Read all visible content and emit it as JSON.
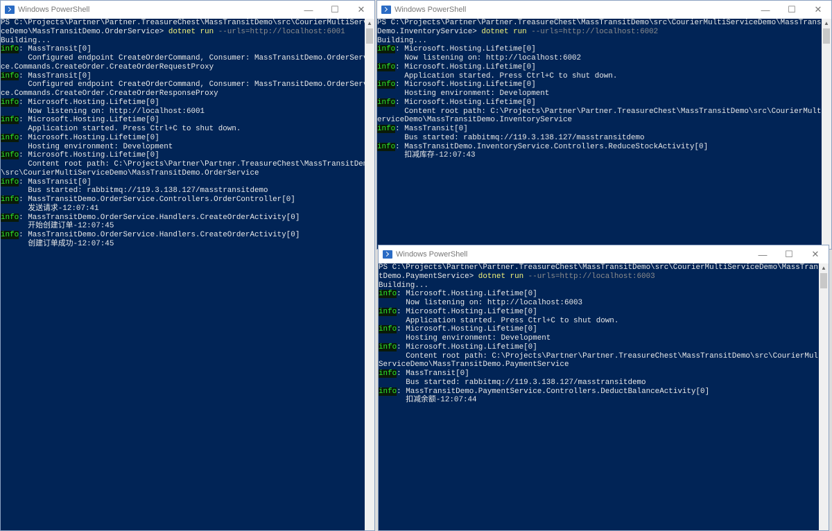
{
  "windows": [
    {
      "title": "Windows PowerShell",
      "controls": {
        "minimize": "—",
        "maximize": "☐",
        "close": "✕"
      },
      "lines": [
        {
          "text": "PS C:\\Projects\\Partner\\Partner.TreasureChest\\MassTransitDemo\\src\\CourierMultiServi"
        },
        {
          "text": "ceDemo\\MassTransitDemo.OrderService> ",
          "cmd": "dotnet run",
          "args": " --urls=http://localhost:6001"
        },
        {
          "text": "Building..."
        },
        {
          "info": "info",
          "text": ": MassTransit[0]"
        },
        {
          "text": "      Configured endpoint CreateOrderCommand, Consumer: MassTransitDemo.OrderServi"
        },
        {
          "text": "ce.Commands.CreateOrder.CreateOrderRequestProxy"
        },
        {
          "info": "info",
          "text": ": MassTransit[0]"
        },
        {
          "text": "      Configured endpoint CreateOrderCommand, Consumer: MassTransitDemo.OrderServi"
        },
        {
          "text": "ce.Commands.CreateOrder.CreateOrderResponseProxy"
        },
        {
          "info": "info",
          "text": ": Microsoft.Hosting.Lifetime[0]"
        },
        {
          "text": "      Now listening on: http://localhost:6001"
        },
        {
          "info": "info",
          "text": ": Microsoft.Hosting.Lifetime[0]"
        },
        {
          "text": "      Application started. Press Ctrl+C to shut down."
        },
        {
          "info": "info",
          "text": ": Microsoft.Hosting.Lifetime[0]"
        },
        {
          "text": "      Hosting environment: Development"
        },
        {
          "info": "info",
          "text": ": Microsoft.Hosting.Lifetime[0]"
        },
        {
          "text": "      Content root path: C:\\Projects\\Partner\\Partner.TreasureChest\\MassTransitDemo"
        },
        {
          "text": "\\src\\CourierMultiServiceDemo\\MassTransitDemo.OrderService"
        },
        {
          "info": "info",
          "text": ": MassTransit[0]"
        },
        {
          "text": "      Bus started: rabbitmq://119.3.138.127/masstransitdemo"
        },
        {
          "info": "info",
          "text": ": MassTransitDemo.OrderService.Controllers.OrderController[0]"
        },
        {
          "text": "      发送请求-12:07:41"
        },
        {
          "info": "info",
          "text": ": MassTransitDemo.OrderService.Handlers.CreateOrderActivity[0]"
        },
        {
          "text": "      开始创建订单-12:07:45"
        },
        {
          "info": "info",
          "text": ": MassTransitDemo.OrderService.Handlers.CreateOrderActivity[0]"
        },
        {
          "text": "      创建订单成功-12:07:45"
        }
      ]
    },
    {
      "title": "Windows PowerShell",
      "controls": {
        "minimize": "—",
        "maximize": "☐",
        "close": "✕"
      },
      "lines": [
        {
          "text": "PS C:\\Projects\\Partner\\Partner.TreasureChest\\MassTransitDemo\\src\\CourierMultiServiceDemo\\MassTransit"
        },
        {
          "text": "Demo.InventoryService> ",
          "cmd": "dotnet run",
          "args": " --urls=http://localhost:6002"
        },
        {
          "text": "Building..."
        },
        {
          "info": "info",
          "text": ": Microsoft.Hosting.Lifetime[0]"
        },
        {
          "text": "      Now listening on: http://localhost:6002"
        },
        {
          "info": "info",
          "text": ": Microsoft.Hosting.Lifetime[0]"
        },
        {
          "text": "      Application started. Press Ctrl+C to shut down."
        },
        {
          "info": "info",
          "text": ": Microsoft.Hosting.Lifetime[0]"
        },
        {
          "text": "      Hosting environment: Development"
        },
        {
          "info": "info",
          "text": ": Microsoft.Hosting.Lifetime[0]"
        },
        {
          "text": "      Content root path: C:\\Projects\\Partner\\Partner.TreasureChest\\MassTransitDemo\\src\\CourierMultiS"
        },
        {
          "text": "erviceDemo\\MassTransitDemo.InventoryService"
        },
        {
          "info": "info",
          "text": ": MassTransit[0]"
        },
        {
          "text": "      Bus started: rabbitmq://119.3.138.127/masstransitdemo"
        },
        {
          "info": "info",
          "text": ": MassTransitDemo.InventoryService.Controllers.ReduceStockActivity[0]"
        },
        {
          "text": "      扣减库存-12:07:43"
        }
      ]
    },
    {
      "title": "Windows PowerShell",
      "controls": {
        "minimize": "—",
        "maximize": "☐",
        "close": "✕"
      },
      "lines": [
        {
          "text": "PS C:\\Projects\\Partner\\Partner.TreasureChest\\MassTransitDemo\\src\\CourierMultiServiceDemo\\MassTransi"
        },
        {
          "text": "tDemo.PaymentService> ",
          "cmd": "dotnet run",
          "args": " --urls=http://localhost:6003"
        },
        {
          "text": "Building..."
        },
        {
          "info": "info",
          "text": ": Microsoft.Hosting.Lifetime[0]"
        },
        {
          "text": "      Now listening on: http://localhost:6003"
        },
        {
          "info": "info",
          "text": ": Microsoft.Hosting.Lifetime[0]"
        },
        {
          "text": "      Application started. Press Ctrl+C to shut down."
        },
        {
          "info": "info",
          "text": ": Microsoft.Hosting.Lifetime[0]"
        },
        {
          "text": "      Hosting environment: Development"
        },
        {
          "info": "info",
          "text": ": Microsoft.Hosting.Lifetime[0]"
        },
        {
          "text": "      Content root path: C:\\Projects\\Partner\\Partner.TreasureChest\\MassTransitDemo\\src\\CourierMulti"
        },
        {
          "text": "ServiceDemo\\MassTransitDemo.PaymentService"
        },
        {
          "info": "info",
          "text": ": MassTransit[0]"
        },
        {
          "text": "      Bus started: rabbitmq://119.3.138.127/masstransitdemo"
        },
        {
          "info": "info",
          "text": ": MassTransitDemo.PaymentService.Controllers.DeductBalanceActivity[0]"
        },
        {
          "text": "      扣减余额-12:07:44"
        }
      ]
    }
  ]
}
